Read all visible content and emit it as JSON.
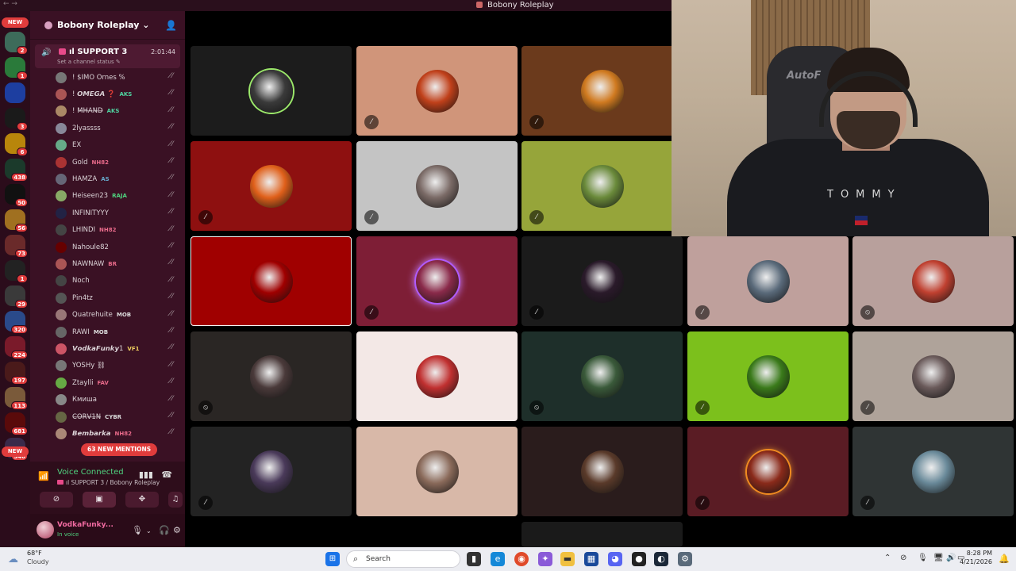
{
  "window": {
    "title": "Bobony Roleplay",
    "nav_arrows": "← →"
  },
  "rail": {
    "new_label": "NEW",
    "servers": [
      {
        "badge": "2",
        "color": "#3d6b5a"
      },
      {
        "badge": "1",
        "color": "#2a7a3a"
      },
      {
        "badge": "",
        "color": "#1d3ea0"
      },
      {
        "badge": "3",
        "color": "#1a1a1a"
      },
      {
        "badge": "6",
        "color": "#b8860b"
      },
      {
        "badge": "438",
        "color": "#1b3a2b"
      },
      {
        "badge": "50",
        "color": "#111111"
      },
      {
        "badge": "56",
        "color": "#a07020"
      },
      {
        "badge": "73",
        "color": "#6a2a2a"
      },
      {
        "badge": "1",
        "color": "#222222"
      },
      {
        "badge": "29",
        "color": "#3a3a3a"
      },
      {
        "badge": "320",
        "color": "#2a4a8a"
      },
      {
        "badge": "224",
        "color": "#7a1a2a"
      },
      {
        "badge": "197",
        "color": "#4a1a1a"
      },
      {
        "badge": "113",
        "color": "#7a5a3a"
      },
      {
        "badge": "681",
        "color": "#5a0a0a"
      },
      {
        "badge": "346",
        "color": "#3a2a4a"
      }
    ],
    "new_bottom_label": "NEW"
  },
  "sidebar": {
    "server_name": "Bobony Roleplay ⌄",
    "voice_channel": {
      "name": "ıl SUPPORT 3",
      "timer": "2:01:44",
      "status": "Set a channel status ✎"
    },
    "members": [
      {
        "name": "! $IMO Ornes %",
        "tag": "",
        "tag_color": "",
        "av": "#777"
      },
      {
        "name": "! 𝙊𝙈𝙀𝙂𝘼 ❓",
        "tag": "AKS",
        "tag_color": "#4fd3a0",
        "av": "#a55"
      },
      {
        "name": "! M̶H̶A̶N̶D̶",
        "tag": "AKS",
        "tag_color": "#4fd3a0",
        "av": "#a86"
      },
      {
        "name": "2lyassss",
        "tag": "",
        "tag_color": "",
        "av": "#889"
      },
      {
        "name": "EX",
        "tag": "",
        "tag_color": "",
        "av": "#6a8"
      },
      {
        "name": "Gold",
        "tag": "NH82",
        "tag_color": "#e86a8a",
        "av": "#a33"
      },
      {
        "name": "HAMZA",
        "tag": "AS",
        "tag_color": "#6ac",
        "av": "#667"
      },
      {
        "name": "Heiseen23",
        "tag": "RAJA",
        "tag_color": "#4fd37f",
        "av": "#8a6"
      },
      {
        "name": "INFINITYYY",
        "tag": "",
        "tag_color": "",
        "av": "#224"
      },
      {
        "name": "LHINDI",
        "tag": "NH82",
        "tag_color": "#e86a8a",
        "av": "#444"
      },
      {
        "name": "Nahoule82",
        "tag": "",
        "tag_color": "",
        "av": "#600"
      },
      {
        "name": "NAWNAW",
        "tag": "BR",
        "tag_color": "#e86a8a",
        "av": "#a55"
      },
      {
        "name": "Noch",
        "tag": "",
        "tag_color": "",
        "av": "#444"
      },
      {
        "name": "Pin4tz",
        "tag": "",
        "tag_color": "",
        "av": "#555"
      },
      {
        "name": "Quatrehuite",
        "tag": "MOB",
        "tag_color": "#ddd",
        "av": "#977"
      },
      {
        "name": "RAWI",
        "tag": "MOB",
        "tag_color": "#ddd",
        "av": "#666"
      },
      {
        "name": "𝙑𝙤𝙙𝙠𝙖𝙁𝙪𝙣𝙠𝙮1",
        "tag": "VF1",
        "tag_color": "#f0d060",
        "av": "#c56"
      },
      {
        "name": "YOSHy ⛓",
        "tag": "",
        "tag_color": "",
        "av": "#777"
      },
      {
        "name": "Ztaylli",
        "tag": "FAV",
        "tag_color": "#e86a8a",
        "av": "#6a4"
      },
      {
        "name": "Кмиша",
        "tag": "",
        "tag_color": "",
        "av": "#888"
      },
      {
        "name": "C̶O̶R̶V̶1̶N̶",
        "tag": "CYBR",
        "tag_color": "#ddd",
        "av": "#664"
      },
      {
        "name": "𝘽𝙚𝙢𝙗𝙖𝙧𝙠𝙖",
        "tag": "NH82",
        "tag_color": "#e86a8a",
        "av": "#a87"
      }
    ],
    "mentions": "63 NEW MENTIONS",
    "voice_panel": {
      "status": "Voice Connected",
      "channel": "ıl SUPPORT 3 / Bobony Roleplay"
    },
    "user": {
      "name": "VodkaFunky...",
      "status": "In voice"
    }
  },
  "tiles": [
    {
      "bg": "#1c1c1c",
      "av": "#3a3a3a",
      "ring": "#9be86a",
      "muted": false,
      "deaf": false
    },
    {
      "bg": "#d0957a",
      "av": "#c0401a",
      "ring": "",
      "muted": true,
      "deaf": false
    },
    {
      "bg": "#6b3a1c",
      "av": "#d07a20",
      "ring": "",
      "muted": true,
      "deaf": false
    },
    {
      "bg": "#8e1010",
      "av": "#e0601a",
      "ring": "",
      "muted": true,
      "deaf": false
    },
    {
      "bg": "#c4c4c4",
      "av": "#7a6a66",
      "ring": "",
      "muted": true,
      "deaf": false
    },
    {
      "bg": "#96a53a",
      "av": "#6a8a3a",
      "ring": "",
      "muted": true,
      "deaf": false
    },
    {
      "bg": "#a00000",
      "av": "#a00000",
      "ring": "",
      "muted": false,
      "deaf": false,
      "selected": true
    },
    {
      "bg": "#7e1e36",
      "av": "#8a2a4a",
      "ring": "speaking",
      "muted": true,
      "deaf": false
    },
    {
      "bg": "#1b1b1b",
      "av": "#2a1a2a",
      "ring": "",
      "muted": true,
      "deaf": false
    },
    {
      "bg": "#bfa09c",
      "av": "#5a6a7a",
      "ring": "",
      "muted": true,
      "deaf": false
    },
    {
      "bg": "#b8a09c",
      "av": "#c04030",
      "ring": "",
      "muted": false,
      "deaf": true
    },
    {
      "bg": "#2a2624",
      "av": "#4a3a3a",
      "ring": "",
      "muted": false,
      "deaf": true
    },
    {
      "bg": "#f3e8e6",
      "av": "#c03030",
      "ring": "",
      "muted": false,
      "deaf": false
    },
    {
      "bg": "#1e2f2a",
      "av": "#3a5a3a",
      "ring": "",
      "muted": false,
      "deaf": true
    },
    {
      "bg": "#7cc01c",
      "av": "#3a7a1a",
      "ring": "",
      "muted": true,
      "deaf": false
    },
    {
      "bg": "#afa39a",
      "av": "#6a5a5a",
      "ring": "",
      "muted": true,
      "deaf": false
    },
    {
      "bg": "#232323",
      "av": "#4a3a5a",
      "ring": "",
      "muted": true,
      "deaf": false
    },
    {
      "bg": "#d8b8a8",
      "av": "#8a6a5a",
      "ring": "",
      "muted": false,
      "deaf": false
    },
    {
      "bg": "#2a1c1c",
      "av": "#5a3a2a",
      "ring": "",
      "muted": false,
      "deaf": false
    },
    {
      "bg": "#5a1c24",
      "av": "#8a2a1a",
      "ring": "fire",
      "muted": true,
      "deaf": false
    },
    {
      "bg": "#2f3434",
      "av": "#6a8a9a",
      "ring": "",
      "muted": true,
      "deaf": false
    },
    {
      "bg": "#1a1a1a",
      "av": "",
      "ring": "",
      "muted": false,
      "deaf": false
    }
  ],
  "webcam": {
    "chair_brand": "AutoF",
    "shirt_text": "TOMMY"
  },
  "taskbar": {
    "temp": "68°F",
    "condition": "Cloudy",
    "search_placeholder": "Search",
    "time": "8:28 PM",
    "date": "4/21/2026"
  }
}
